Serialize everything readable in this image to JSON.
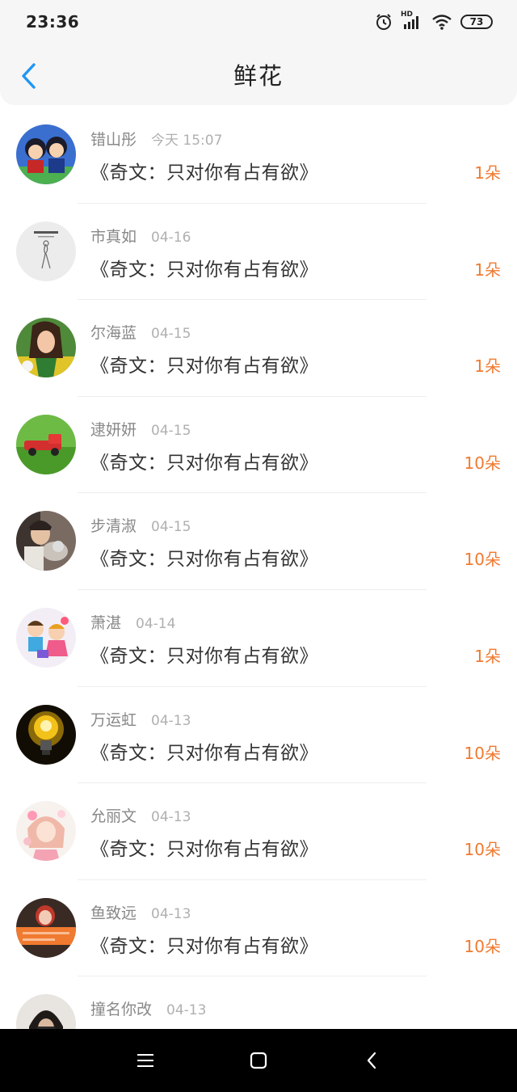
{
  "status_bar": {
    "time": "23:36",
    "battery": "73",
    "network": "HD"
  },
  "header": {
    "title": "鲜花"
  },
  "colors": {
    "accent": "#f07a30",
    "back_arrow": "#2196f3"
  },
  "items": [
    {
      "name": "错山彤",
      "date": "今天 15:07",
      "book": "《奇文：只对你有占有欲》",
      "count": "1朵",
      "avatar": "cartoon-couple-avatar"
    },
    {
      "name": "市真如",
      "date": "04-16",
      "book": "《奇文：只对你有占有欲》",
      "count": "1朵",
      "avatar": "memory-sketch-avatar"
    },
    {
      "name": "尔海蓝",
      "date": "04-15",
      "book": "《奇文：只对你有占有欲》",
      "count": "1朵",
      "avatar": "woman-photo-avatar"
    },
    {
      "name": "逮妍妍",
      "date": "04-15",
      "book": "《奇文：只对你有占有欲》",
      "count": "10朵",
      "avatar": "red-toy-truck-avatar"
    },
    {
      "name": "步清淑",
      "date": "04-15",
      "book": "《奇文：只对你有占有欲》",
      "count": "10朵",
      "avatar": "person-with-cat-avatar"
    },
    {
      "name": "萧湛",
      "date": "04-14",
      "book": "《奇文：只对你有占有欲》",
      "count": "1朵",
      "avatar": "cartoon-kids-avatar"
    },
    {
      "name": "万运虹",
      "date": "04-13",
      "book": "《奇文：只对你有占有欲》",
      "count": "10朵",
      "avatar": "light-bulb-avatar"
    },
    {
      "name": "允丽文",
      "date": "04-13",
      "book": "《奇文：只对你有占有欲》",
      "count": "10朵",
      "avatar": "anime-girl-avatar"
    },
    {
      "name": "鱼致远",
      "date": "04-13",
      "book": "《奇文：只对你有占有欲》",
      "count": "10朵",
      "avatar": "orange-banner-avatar"
    },
    {
      "name": "撞名你改",
      "date": "04-13",
      "book": "",
      "count": "",
      "avatar": "dark-hair-avatar"
    }
  ]
}
